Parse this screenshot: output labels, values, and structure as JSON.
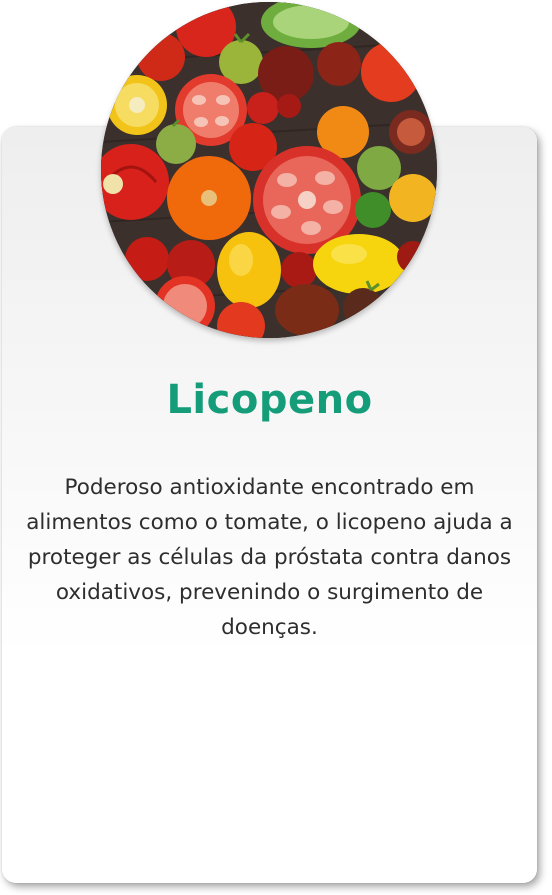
{
  "card": {
    "title": "Licopeno",
    "description": "Poderoso antioxidante encontrado em alimentos como o tomate, o licopeno ajuda a proteger as células da próstata contra danos oxidativos, prevenindo o surgimento de doenças.",
    "title_color": "#159d79",
    "text_color": "#2e2e2e"
  },
  "image": {
    "subject": "tomatoes"
  }
}
